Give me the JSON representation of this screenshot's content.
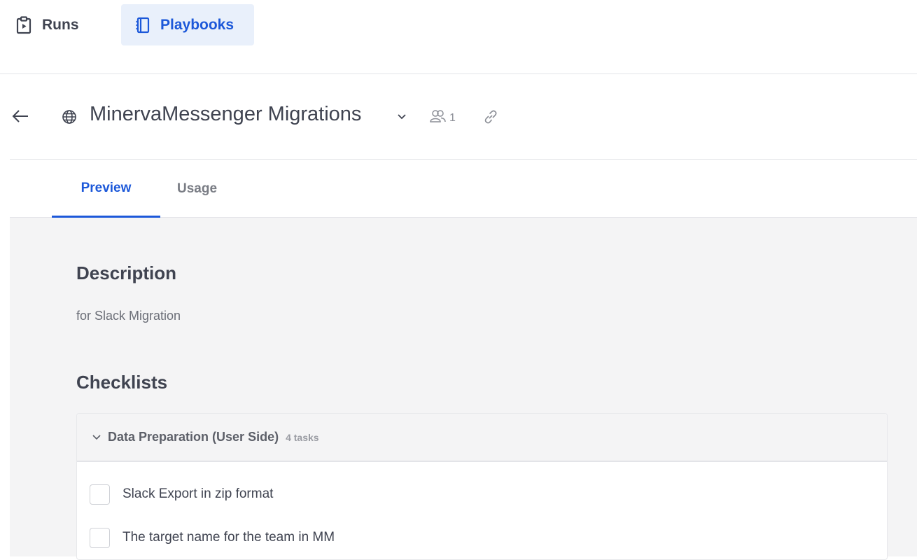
{
  "nav": {
    "runs_label": "Runs",
    "playbooks_label": "Playbooks",
    "active": "Playbooks"
  },
  "header": {
    "title": "MinervaMessenger Migrations",
    "member_count": "1"
  },
  "tabs": [
    {
      "label": "Preview",
      "active": true
    },
    {
      "label": "Usage",
      "active": false
    }
  ],
  "description": {
    "heading": "Description",
    "text": "for Slack Migration"
  },
  "checklists": {
    "heading": "Checklists",
    "groups": [
      {
        "title": "Data Preparation (User Side)",
        "count_label": "4 tasks",
        "items": [
          {
            "label": "Slack Export in zip format",
            "checked": false
          },
          {
            "label": "The target name for the team in MM",
            "checked": false
          }
        ]
      }
    ]
  },
  "colors": {
    "accent": "#1c58d9",
    "active_nav_bg": "#e9f0fb",
    "content_bg": "#f4f4f5"
  }
}
